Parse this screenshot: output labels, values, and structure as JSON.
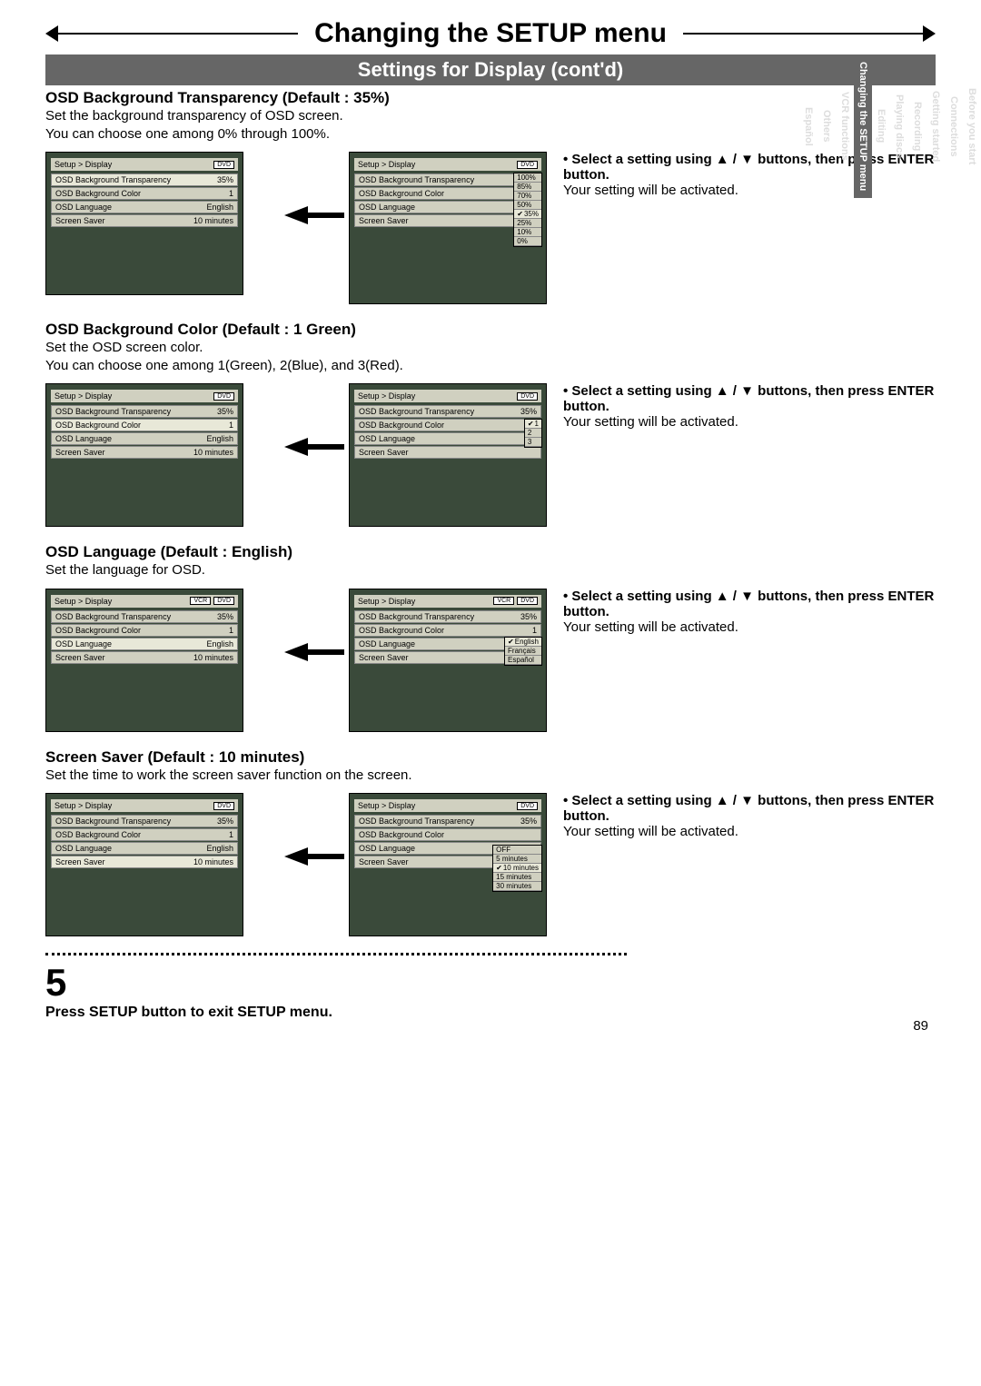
{
  "page_number": "89",
  "title": "Changing the SETUP menu",
  "subtitle": "Settings for Display (cont'd)",
  "side_tabs": [
    "Before you start",
    "Connections",
    "Getting started",
    "Recording",
    "Playing discs",
    "Editing",
    "Changing the SETUP menu",
    "VCR functions",
    "Others",
    "Español"
  ],
  "side_tab_current_index": 6,
  "instruction_line1": "• Select a setting using ▲ / ▼ buttons, then press ENTER button.",
  "instruction_line2": "Your setting will be activated.",
  "sec1": {
    "head": "OSD Background Transparency (Default : 35%)",
    "desc1": "Set the background transparency of OSD screen.",
    "desc2": "You can choose one among 0% through 100%.",
    "left_title": "Setup > Display",
    "left_badge": "DVD",
    "left_rows": [
      [
        "OSD Background Transparency",
        "35%"
      ],
      [
        "OSD Background Color",
        "1"
      ],
      [
        "OSD Language",
        "English"
      ],
      [
        "Screen Saver",
        "10 minutes"
      ]
    ],
    "right_title": "Setup > Display",
    "right_badge": "DVD",
    "right_rows": [
      "OSD Background Transparency",
      "OSD Background Color",
      "OSD Language",
      "Screen Saver"
    ],
    "popup": [
      "100%",
      "85%",
      "70%",
      "50%",
      "35%",
      "25%",
      "10%",
      "0%"
    ],
    "popup_sel": 4
  },
  "sec2": {
    "head": "OSD Background Color (Default : 1 Green)",
    "desc1": "Set the OSD screen color.",
    "desc2": "You can choose one among 1(Green), 2(Blue), and 3(Red).",
    "left_title": "Setup > Display",
    "left_badge": "DVD",
    "left_rows": [
      [
        "OSD Background Transparency",
        "35%"
      ],
      [
        "OSD Background Color",
        "1"
      ],
      [
        "OSD Language",
        "English"
      ],
      [
        "Screen Saver",
        "10 minutes"
      ]
    ],
    "right_title": "Setup > Display",
    "right_badge": "DVD",
    "right_rows": [
      [
        "OSD Background Transparency",
        "35%"
      ],
      [
        "OSD Background Color",
        ""
      ],
      [
        "OSD Language",
        ""
      ],
      [
        "Screen Saver",
        ""
      ]
    ],
    "popup": [
      "1",
      "2",
      "3"
    ],
    "popup_sel": 0
  },
  "sec3": {
    "head": "OSD Language (Default : English)",
    "desc1": "Set the language for OSD.",
    "left_title": "Setup > Display",
    "left_badges": [
      "VCR",
      "DVD"
    ],
    "left_rows": [
      [
        "OSD Background Transparency",
        "35%"
      ],
      [
        "OSD Background Color",
        "1"
      ],
      [
        "OSD Language",
        "English"
      ],
      [
        "Screen Saver",
        "10 minutes"
      ]
    ],
    "right_title": "Setup > Display",
    "right_badges": [
      "VCR",
      "DVD"
    ],
    "right_rows": [
      [
        "OSD Background Transparency",
        "35%"
      ],
      [
        "OSD Background Color",
        "1"
      ],
      [
        "OSD Language",
        ""
      ],
      [
        "Screen Saver",
        ""
      ]
    ],
    "popup": [
      "English",
      "Français",
      "Español"
    ],
    "popup_sel": 0
  },
  "sec4": {
    "head": "Screen Saver (Default : 10 minutes)",
    "desc1": "Set the time to work the screen saver function on the screen.",
    "left_title": "Setup > Display",
    "left_badge": "DVD",
    "left_rows": [
      [
        "OSD Background Transparency",
        "35%"
      ],
      [
        "OSD Background Color",
        "1"
      ],
      [
        "OSD Language",
        "English"
      ],
      [
        "Screen Saver",
        "10 minutes"
      ]
    ],
    "right_title": "Setup > Display",
    "right_badge": "DVD",
    "right_rows": [
      [
        "OSD Background Transparency",
        "35%"
      ],
      [
        "OSD Background Color",
        ""
      ],
      [
        "OSD Language",
        ""
      ],
      [
        "Screen Saver",
        ""
      ]
    ],
    "popup": [
      "OFF",
      "5 minutes",
      "10 minutes",
      "15 minutes",
      "30 minutes"
    ],
    "popup_sel": 2
  },
  "step5_num": "5",
  "step5_text": "Press SETUP button to exit SETUP menu."
}
